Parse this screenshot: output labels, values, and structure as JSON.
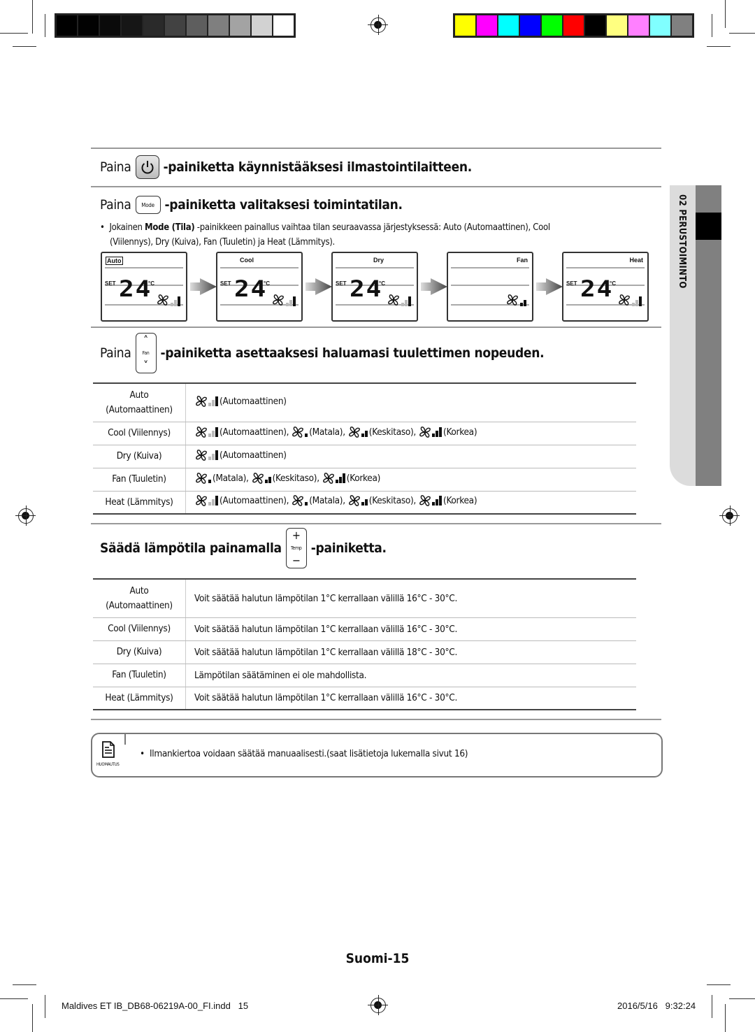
{
  "print_marks": {
    "gray_swatches": [
      "#000000",
      "#020202",
      "#0a0a0a",
      "#161616",
      "#2a2a2a",
      "#424242",
      "#5e5e5e",
      "#7f7f7f",
      "#a3a3a3",
      "#d2d2d2",
      "#ffffff"
    ],
    "color_swatches": [
      "#ffff00",
      "#ff00ff",
      "#00ffff",
      "#0000ff",
      "#00ff00",
      "#ff0000",
      "#000000",
      "#ffff80",
      "#ff80ff",
      "#80ffff",
      "#808080"
    ]
  },
  "side_tab": {
    "label": "02  PERUSTOIMINTO"
  },
  "section_power": {
    "prefix": "Paina",
    "suffix": "-painiketta käynnistääksesi ilmastointilaitteen.",
    "button_icon": "power-icon"
  },
  "section_mode": {
    "prefix": "Paina",
    "button_label": "Mode",
    "suffix": "-painiketta valitaksesi toimintatilan.",
    "bullet": {
      "pre": "Jokainen ",
      "bold": "Mode (Tila)",
      "line1_rest": " -painikkeen painallus vaihtaa tilan seuraavassa järjestyksessä: Auto (Automaattinen), Cool",
      "line2": "(Viilennys), Dry (Kuiva), Fan (Tuuletin) ja Heat (Lämmitys)."
    },
    "displays": [
      {
        "mode": "Auto",
        "set": "SET",
        "temp": "24",
        "unit": "°C",
        "fan_bars": [
          "off",
          "off",
          "on"
        ],
        "show_temp": true
      },
      {
        "mode": "Cool",
        "set": "SET",
        "temp": "24",
        "unit": "°C",
        "fan_bars": [
          "off",
          "off",
          "on"
        ],
        "show_temp": true
      },
      {
        "mode": "Dry",
        "set": "SET",
        "temp": "24",
        "unit": "°C",
        "fan_bars": [
          "off",
          "off",
          "on"
        ],
        "show_temp": true
      },
      {
        "mode": "Fan",
        "set": "",
        "temp": "",
        "unit": "",
        "fan_bars": [
          "on",
          "on"
        ],
        "show_temp": false
      },
      {
        "mode": "Heat",
        "set": "SET",
        "temp": "24",
        "unit": "°C",
        "fan_bars": [
          "off",
          "off",
          "on"
        ],
        "show_temp": true
      }
    ]
  },
  "section_fan": {
    "prefix": "Paina",
    "button_label": "Fan",
    "suffix": "-painiketta asettaaksesi haluamasi tuulettimen nopeuden.",
    "rows": [
      {
        "mode": "Auto\n(Automaattinen)",
        "options": [
          {
            "level": "auto",
            "label": "(Automaattinen)"
          }
        ]
      },
      {
        "mode": "Cool (Viilennys)",
        "options": [
          {
            "level": "auto",
            "label": "(Automaattinen),"
          },
          {
            "level": "low",
            "label": "(Matala),"
          },
          {
            "level": "mid",
            "label": "(Keskitaso),"
          },
          {
            "level": "high",
            "label": "(Korkea)"
          }
        ]
      },
      {
        "mode": "Dry (Kuiva)",
        "options": [
          {
            "level": "auto",
            "label": "(Automaattinen)"
          }
        ]
      },
      {
        "mode": "Fan (Tuuletin)",
        "options": [
          {
            "level": "low",
            "label": "(Matala),"
          },
          {
            "level": "mid",
            "label": "(Keskitaso),"
          },
          {
            "level": "high",
            "label": "(Korkea)"
          }
        ]
      },
      {
        "mode": "Heat (Lämmitys)",
        "options": [
          {
            "level": "auto",
            "label": "(Automaattinen),"
          },
          {
            "level": "low",
            "label": "(Matala),"
          },
          {
            "level": "mid",
            "label": "(Keskitaso),"
          },
          {
            "level": "high",
            "label": "(Korkea)"
          }
        ]
      }
    ]
  },
  "section_temp": {
    "prefix": "Säädä lämpötila painamalla",
    "button_label": "Temp",
    "button_plus": "+",
    "button_minus": "−",
    "suffix": "-painiketta.",
    "rows": [
      {
        "mode": "Auto\n(Automaattinen)",
        "desc": "Voit säätää halutun lämpötilan 1°C kerrallaan välillä 16°C - 30°C."
      },
      {
        "mode": "Cool (Viilennys)",
        "desc": "Voit säätää halutun lämpötilan 1°C kerrallaan välillä 16°C - 30°C."
      },
      {
        "mode": "Dry (Kuiva)",
        "desc": "Voit säätää halutun lämpötilan 1°C kerrallaan välillä 18°C - 30°C."
      },
      {
        "mode": "Fan (Tuuletin)",
        "desc": "Lämpötilan säätäminen ei ole mahdollista."
      },
      {
        "mode": "Heat (Lämmitys)",
        "desc": "Voit säätää halutun lämpötilan 1°C kerrallaan välillä 16°C - 30°C."
      }
    ]
  },
  "note": {
    "icon_label": "HUOMAUTUS",
    "text": "Ilmankiertoa voidaan säätää manuaalisesti.(saat lisätietoja lukemalla sivut 16)"
  },
  "page_number": "Suomi-15",
  "footer": {
    "file": "Maldives ET IB_DB68-06219A-00_FI.indd   15",
    "timestamp": "2016/5/16   9:32:24"
  }
}
